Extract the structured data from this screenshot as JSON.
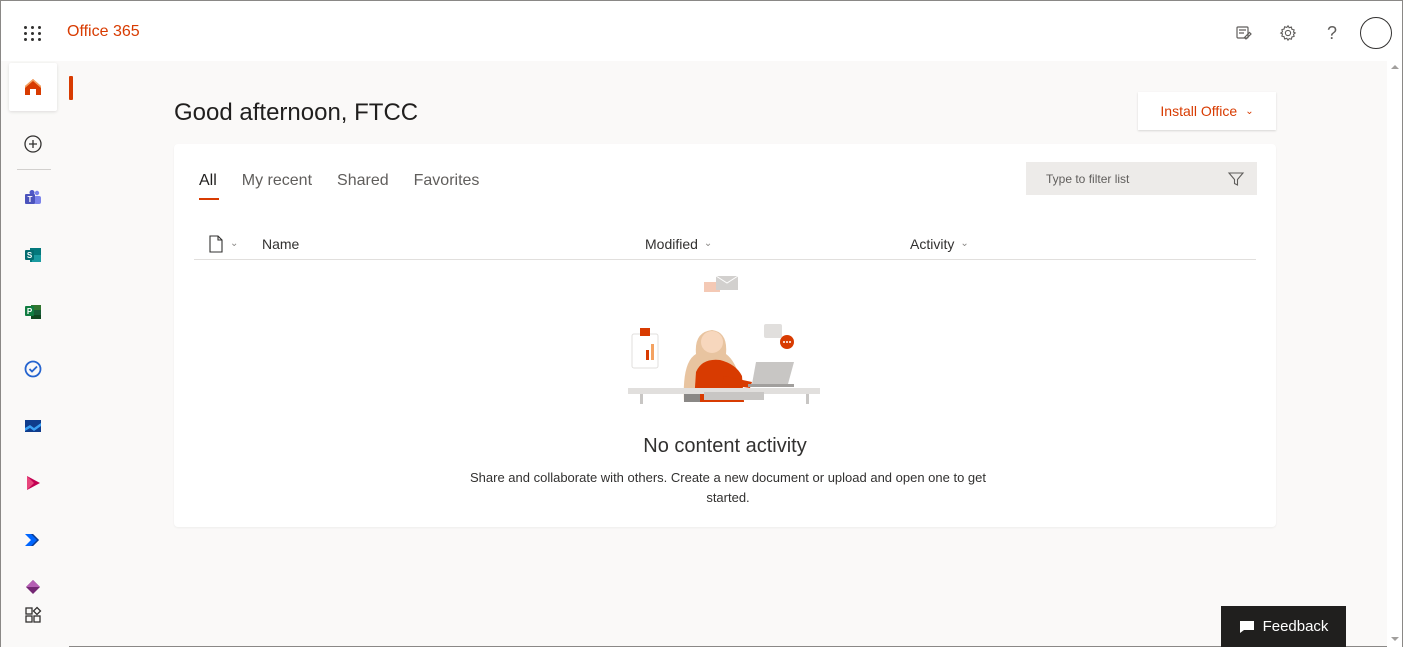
{
  "app": {
    "brand": "Office 365"
  },
  "header": {
    "greeting": "Good afternoon, FTCC",
    "install_label": "Install Office"
  },
  "tabs": [
    {
      "label": "All",
      "active": true
    },
    {
      "label": "My recent",
      "active": false
    },
    {
      "label": "Shared",
      "active": false
    },
    {
      "label": "Favorites",
      "active": false
    }
  ],
  "filter": {
    "placeholder": "Type to filter list"
  },
  "columns": {
    "name": "Name",
    "modified": "Modified",
    "activity": "Activity"
  },
  "empty_state": {
    "title": "No content activity",
    "description": "Share and collaborate with others. Create a new document or upload and open one to get started."
  },
  "feedback": {
    "label": "Feedback"
  },
  "rail": [
    {
      "name": "home-icon"
    },
    {
      "name": "create-icon"
    },
    {
      "name": "teams-icon"
    },
    {
      "name": "sharepoint-icon"
    },
    {
      "name": "project-icon"
    },
    {
      "name": "todo-icon"
    },
    {
      "name": "kaizala-icon"
    },
    {
      "name": "stream-icon"
    },
    {
      "name": "power-automate-icon"
    },
    {
      "name": "power-apps-icon"
    },
    {
      "name": "all-apps-icon"
    }
  ],
  "colors": {
    "accent": "#d83b01",
    "background": "#faf9f8",
    "card": "#ffffff"
  }
}
